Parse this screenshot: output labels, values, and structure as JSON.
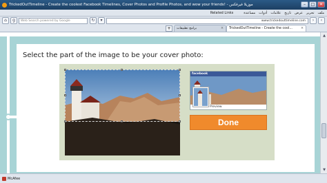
{
  "window": {
    "title": "TrickedOutTimeline - Create the coolest Facebook Timelines, Cover Photos and Profile Photos, and wow your friends! - موزيلا فيرفكس",
    "minimize": "–",
    "maximize": "□",
    "close": "✕"
  },
  "menubar": {
    "bookmark_link": "Related Links",
    "items": [
      "ملف",
      "تحرير",
      "عرض",
      "تاريخ",
      "علامات",
      "أدوات",
      "مساعدة"
    ]
  },
  "toolbar": {
    "search_placeholder": "Web Search powered by Google",
    "url": "www.trickedouttimeline.com"
  },
  "tabs": [
    {
      "label": "برامج تطبيقات"
    },
    {
      "label": "TrickedOutTimeline - Create the cool..."
    }
  ],
  "page": {
    "instruction": "Select the part of the image to be your cover photo:",
    "preview_brand": "facebook",
    "preview_label": "Preview",
    "done_button": "Done"
  },
  "statusbar": {
    "mcafee": "McAfee"
  }
}
